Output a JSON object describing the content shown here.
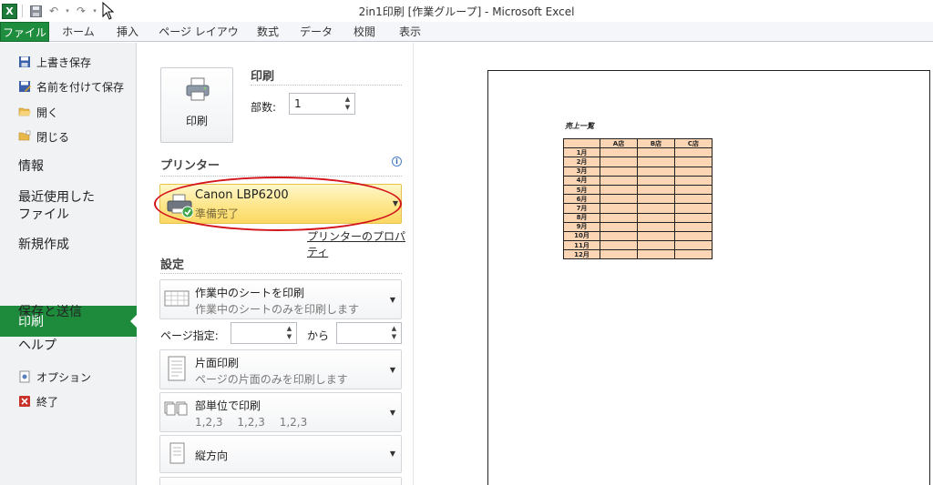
{
  "window": {
    "title": "2in1印刷 [作業グループ] - Microsoft Excel"
  },
  "ribbon_tabs": [
    "ファイル",
    "ホーム",
    "挿入",
    "ページ レイアウト",
    "数式",
    "データ",
    "校閲",
    "表示"
  ],
  "left_nav": {
    "small_top": [
      "上書き保存",
      "名前を付けて保存",
      "開く",
      "閉じる"
    ],
    "info": "情報",
    "recent_line1": "最近使用した",
    "recent_line2": "ファイル",
    "new": "新規作成",
    "print": "印刷",
    "save_send": "保存と送信",
    "help": "ヘルプ",
    "options": "オプション",
    "exit": "終了"
  },
  "print_panel": {
    "section_title": "印刷",
    "print_button": "印刷",
    "copies_label": "部数:",
    "copies_value": "1",
    "printer_heading": "プリンター",
    "printer_name": "Canon LBP6200",
    "printer_status": "準備完了",
    "printer_props_link": "プリンターのプロパティ",
    "settings_heading": "設定",
    "setting_scope_title": "作業中のシートを印刷",
    "setting_scope_desc": "作業中のシートのみを印刷します",
    "pages_label": "ページ指定:",
    "pages_to": "から",
    "setting_sides_title": "片面印刷",
    "setting_sides_desc": "ページの片面のみを印刷します",
    "setting_collate_title": "部単位で印刷",
    "setting_collate_desc": "1,2,3　 1,2,3　 1,2,3",
    "setting_orient_title": "縦方向"
  },
  "preview": {
    "sheet_title": "売上一覧",
    "columns": [
      "",
      "A店",
      "B店",
      "C店"
    ],
    "months": [
      "1月",
      "2月",
      "3月",
      "4月",
      "5月",
      "6月",
      "7月",
      "8月",
      "9月",
      "10月",
      "11月",
      "12月"
    ]
  },
  "colors": {
    "accent_green": "#1e8a3c",
    "highlight_yellow": "#fde68a",
    "annotation_red": "#d4141b",
    "cell_fill": "#fcd5b4"
  }
}
